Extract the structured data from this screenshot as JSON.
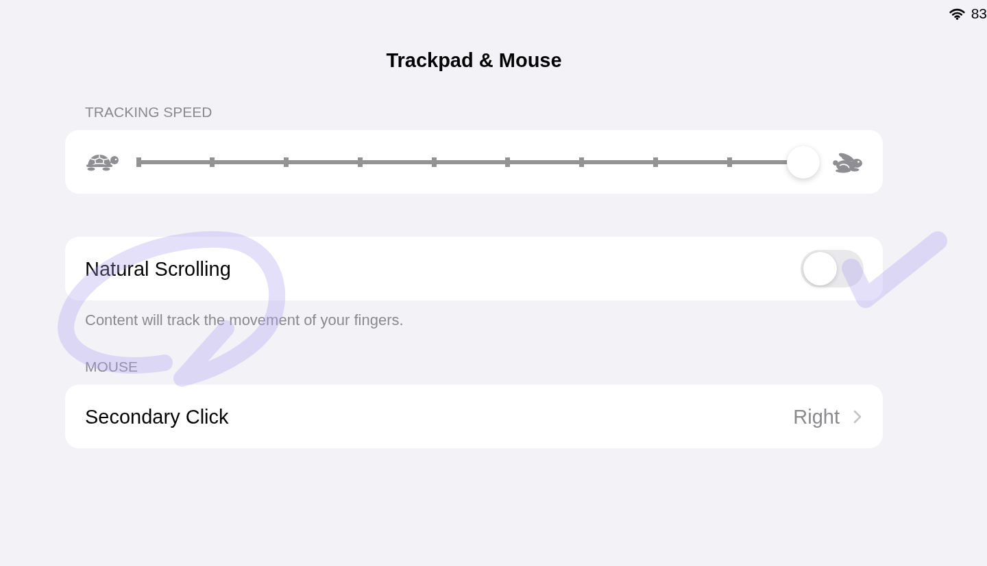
{
  "status_bar": {
    "battery": "83"
  },
  "title": "Trackpad & Mouse",
  "sections": [
    {
      "header": "TRACKING SPEED",
      "rows": [
        {
          "kind": "slider",
          "level": 1
        }
      ]
    },
    {
      "rows": [
        {
          "kind": "toggle",
          "label": "Natural Scrolling",
          "on": false
        }
      ],
      "footer": "Content will track the movement of your fingers."
    },
    {
      "header": "MOUSE",
      "rows": [
        {
          "kind": "link",
          "label": "Secondary Click",
          "value": "Right"
        }
      ]
    }
  ]
}
